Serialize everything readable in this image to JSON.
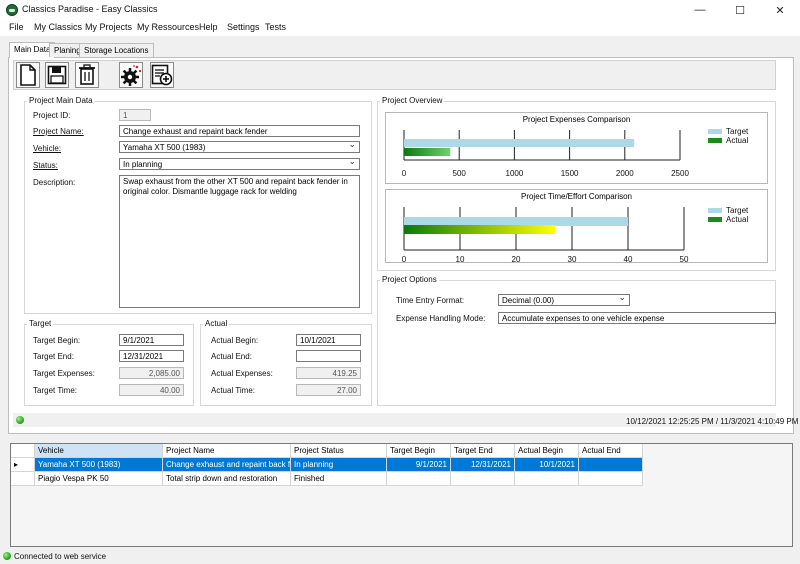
{
  "window": {
    "title": "Classics Paradise - Easy Classics",
    "minimize": "—",
    "maximize": "☐",
    "close": "✕"
  },
  "menu": [
    "File",
    "My Classics",
    "My Projects",
    "My Ressources",
    "Help",
    "Settings",
    "Tests"
  ],
  "tabs": [
    "Main Data",
    "Planing",
    "Storage Locations"
  ],
  "toolbar": {
    "buttons": [
      "new-document-icon",
      "save-icon",
      "delete-icon",
      "settings-gear-icon",
      "add-entry-icon"
    ]
  },
  "project_main": {
    "group_title": "Project Main Data",
    "id_label": "Project ID:",
    "id_value": "1",
    "name_label": "Project Name:",
    "name_value": "Change exhaust and repaint back fender",
    "vehicle_label": "Vehicle:",
    "vehicle_value": "Yamaha XT 500 (1983)",
    "status_label": "Status:",
    "status_value": "In planning",
    "description_label": "Description:",
    "description_value": "Swap exhaust from the other XT 500 and repaint back fender in original color. Dismantle luggage rack for welding"
  },
  "target": {
    "group_title": "Target",
    "begin_label": "Target Begin:",
    "begin_value": "9/1/2021",
    "end_label": "Target End:",
    "end_value": "12/31/2021",
    "expenses_label": "Target Expenses:",
    "expenses_value": "2,085.00",
    "time_label": "Target Time:",
    "time_value": "40.00"
  },
  "actual": {
    "group_title": "Actual",
    "begin_label": "Actual Begin:",
    "begin_value": "10/1/2021",
    "end_label": "Actual End:",
    "end_value": "",
    "expenses_label": "Actual Expenses:",
    "expenses_value": "419.25",
    "time_label": "Actual Time:",
    "time_value": "27.00"
  },
  "overview": {
    "group_title": "Project Overview"
  },
  "chart_data": [
    {
      "type": "bar",
      "title": "Project Expenses Comparison",
      "series": [
        {
          "name": "Target",
          "values": [
            2085
          ],
          "color": "#add8e6"
        },
        {
          "name": "Actual",
          "values": [
            419.25
          ],
          "color": "#1a8c1a"
        }
      ],
      "xlim": [
        0,
        2500
      ],
      "xticks": [
        "0",
        "500",
        "1000",
        "1500",
        "2000",
        "2500"
      ],
      "legend": "right",
      "grid": true
    },
    {
      "type": "bar",
      "title": "Project Time/Effort Comparison",
      "series": [
        {
          "name": "Target",
          "values": [
            40
          ],
          "color": "#add8e6"
        },
        {
          "name": "Actual",
          "values": [
            27
          ],
          "color": "#1a8c1a"
        }
      ],
      "xlim": [
        0,
        50
      ],
      "xticks": [
        "0",
        "10",
        "20",
        "30",
        "40",
        "50"
      ],
      "legend": "right",
      "grid": true
    }
  ],
  "options": {
    "group_title": "Project Options",
    "time_format_label": "Time Entry Format:",
    "time_format_value": "Decimal (0.00)",
    "expense_mode_label": "Expense Handling Mode:",
    "expense_mode_value": "Accumulate expenses to one vehicle expense"
  },
  "strip": {
    "timestamps": "10/12/2021 12:25:25 PM / 11/3/2021 4:10:49 PM"
  },
  "grid": {
    "columns": [
      "Vehicle",
      "Project Name",
      "Project Status",
      "Target Begin",
      "Target End",
      "Actual Begin",
      "Actual End"
    ],
    "rows": [
      [
        "Yamaha XT 500 (1983)",
        "Change exhaust and repaint back fen...",
        "In planning",
        "9/1/2021",
        "12/31/2021",
        "10/1/2021",
        ""
      ],
      [
        "Piagio Vespa PK 50",
        "Total strip down and restoration",
        "Finished",
        "",
        "",
        "",
        ""
      ]
    ]
  },
  "statusbar": {
    "text": "Connected to web service"
  }
}
